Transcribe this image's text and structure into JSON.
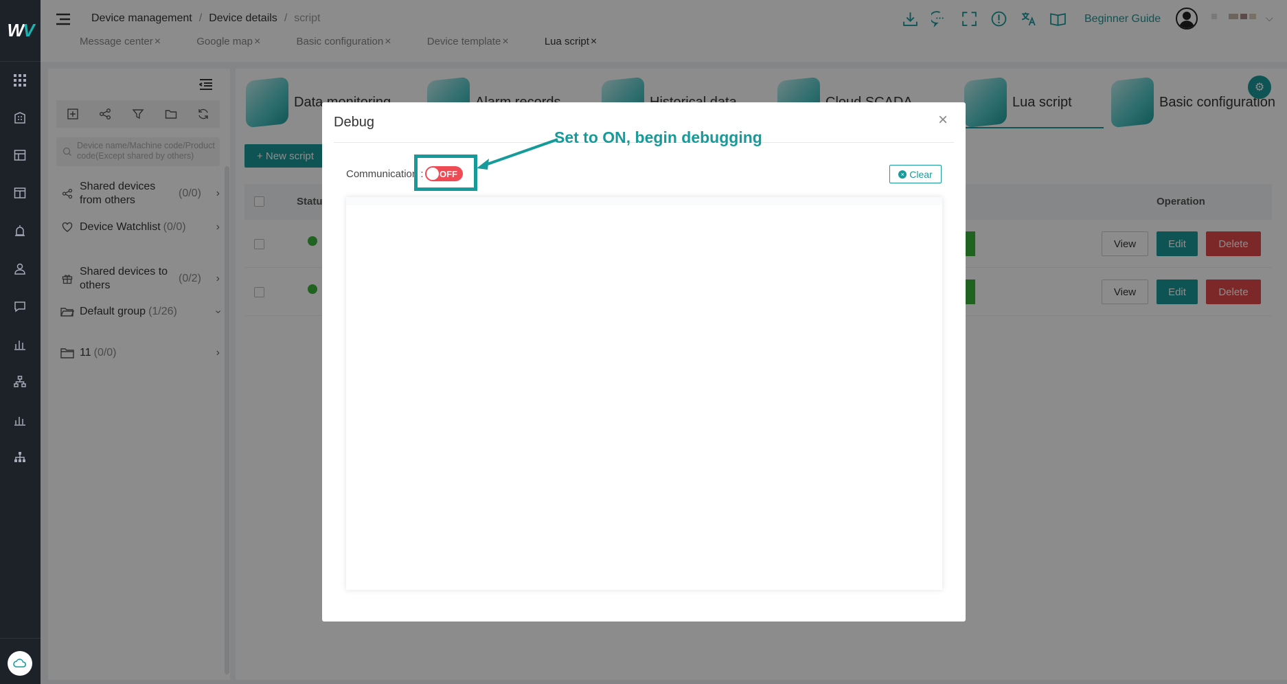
{
  "header": {
    "breadcrumb": [
      "Device management",
      "Device details",
      "script"
    ],
    "breadcrumb_sep": "/",
    "tabs": [
      {
        "label": "Message center"
      },
      {
        "label": "Google map"
      },
      {
        "label": "Basic configuration"
      },
      {
        "label": "Device template"
      },
      {
        "label": "Lua script"
      }
    ],
    "active_tab": "Lua script",
    "icons": [
      "download-icon",
      "chat-icon",
      "fullscreen-icon",
      "info-icon",
      "translate-icon",
      "help-book-icon"
    ],
    "guide_label": "Beginner Guide"
  },
  "sidebar": {
    "search_placeholder": "Device name/Machine code/Product code(Except shared by others)",
    "tools": [
      "add-icon",
      "share-icon",
      "filter-icon",
      "folder-icon",
      "refresh-icon"
    ],
    "items": [
      {
        "label": "Shared devices from others",
        "count": "(0/0)",
        "icon": "share-icon"
      },
      {
        "label": "Device Watchlist",
        "count": "(0/0)",
        "icon": "heart-icon"
      },
      {
        "label": "Shared devices to others",
        "count": "(0/2)",
        "icon": "gift-icon"
      },
      {
        "label": "Default group",
        "count": "(1/26)",
        "icon": "folder-open-icon"
      },
      {
        "label": "11",
        "count": "(0/0)",
        "icon": "folder-icon"
      }
    ]
  },
  "main": {
    "features": [
      {
        "label": "Data monitoring"
      },
      {
        "label": "Alarm records"
      },
      {
        "label": "Historical data"
      },
      {
        "label": "Cloud SCADA"
      },
      {
        "label": "Lua script"
      },
      {
        "label": "Basic configuration"
      }
    ],
    "active_feature": "Lua script",
    "new_script_label": "+ New script",
    "table": {
      "status_header": "Status",
      "operation_header": "Operation",
      "row_actions": {
        "view": "View",
        "edit": "Edit",
        "delete": "Delete"
      },
      "rows": 2
    }
  },
  "modal": {
    "title": "Debug",
    "close_label": "×",
    "communication_label": "Communication :",
    "toggle_state": "OFF",
    "clear_label": "Clear"
  },
  "annotation": {
    "text": "Set to ON, begin debugging"
  },
  "colors": {
    "accent": "#1a9a9a",
    "toggle_off": "#ef4b55",
    "delete": "#e24a4a",
    "status_online": "#3bb33b",
    "rail": "#1c2227"
  }
}
